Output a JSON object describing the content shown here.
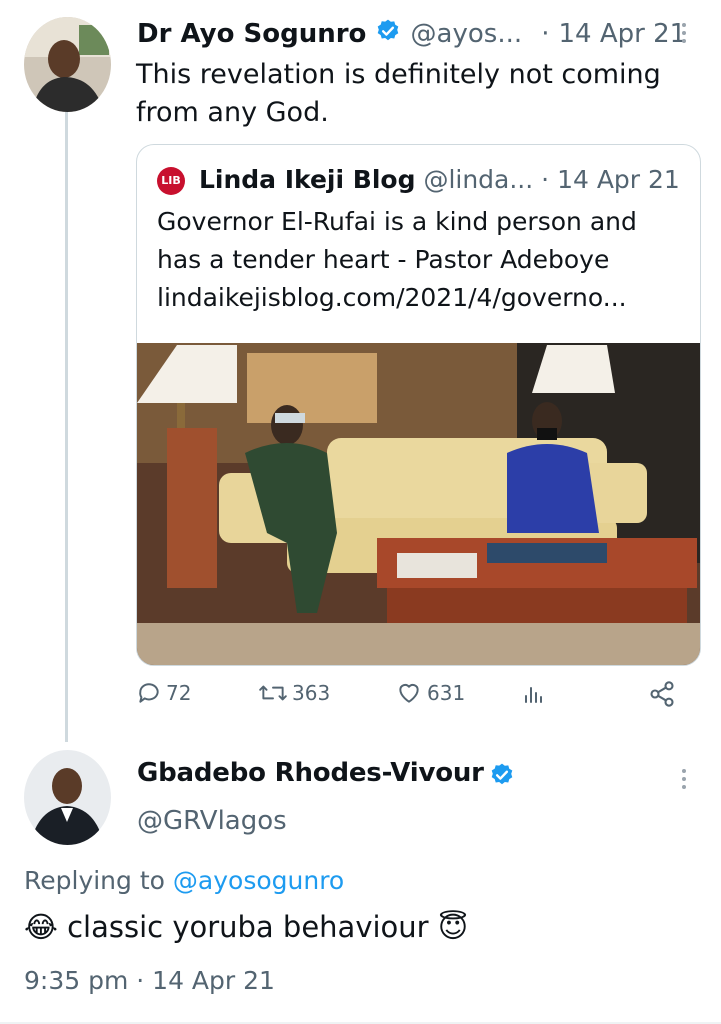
{
  "tweet": {
    "author_name": "Dr Ayo Sogunro",
    "author_handle": "@ayos...",
    "separator": "·",
    "date": "14 Apr 21",
    "text_line1": "This revelation is definitely not coming",
    "text_line2": "from any God.",
    "verified": true
  },
  "quoted": {
    "logo_text": "LIB",
    "author_name": "Linda Ikeji Blog",
    "author_handle": "@linda...",
    "separator": "·",
    "date": "14 Apr 21",
    "text_line1": "Governor El-Rufai is a kind person and",
    "text_line2": "has a tender heart - Pastor Adeboye",
    "link": "lindaikejisblog.com/2021/4/governo..."
  },
  "actions": {
    "replies": "72",
    "retweets": "363",
    "likes": "631"
  },
  "reply": {
    "author_name": "Gbadebo Rhodes-Vivour",
    "author_handle": "@GRVlagos",
    "replying_prefix": "Replying to",
    "replying_handle": "@ayosogunro",
    "text": "classic yoruba behaviour",
    "emoji_before": "😂",
    "emoji_after": "😇",
    "time": "9:35 pm",
    "separator": "·",
    "date": "14 Apr 21",
    "verified": true
  },
  "colors": {
    "link": "#1d9bf0",
    "verified": "#1d9bf0",
    "muted": "#536471",
    "brand_lib": "#c8102e"
  }
}
